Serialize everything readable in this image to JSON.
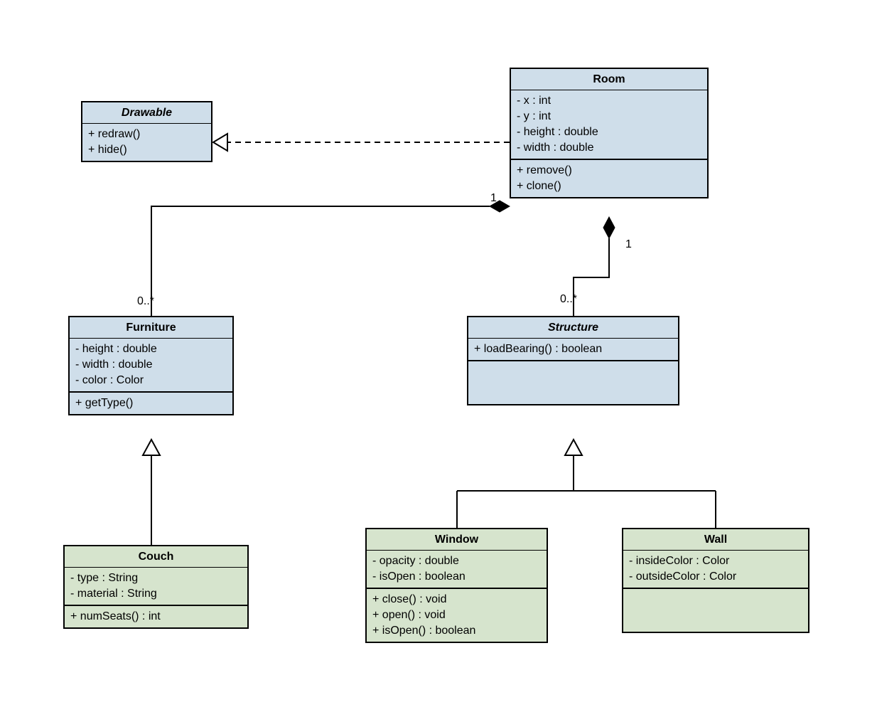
{
  "classes": {
    "drawable": {
      "name": "Drawable",
      "abstract": true,
      "methods": [
        "+ redraw()",
        "+ hide()"
      ]
    },
    "room": {
      "name": "Room",
      "attributes": [
        "- x : int",
        "- y : int",
        "- height : double",
        "- width : double"
      ],
      "methods": [
        "+ remove()",
        "+ clone()"
      ]
    },
    "furniture": {
      "name": "Furniture",
      "attributes": [
        "- height : double",
        "- width : double",
        "- color : Color"
      ],
      "methods": [
        "+ getType()"
      ]
    },
    "structure": {
      "name": "Structure",
      "abstract": true,
      "methods": [
        "+ loadBearing() : boolean"
      ]
    },
    "couch": {
      "name": "Couch",
      "attributes": [
        "- type : String",
        "- material : String"
      ],
      "methods": [
        "+ numSeats() : int"
      ]
    },
    "window": {
      "name": "Window",
      "attributes": [
        "- opacity : double",
        "- isOpen : boolean"
      ],
      "methods": [
        "+ close() : void",
        "+ open() : void",
        "+ isOpen() : boolean"
      ]
    },
    "wall": {
      "name": "Wall",
      "attributes": [
        "- insideColor : Color",
        "- outsideColor : Color"
      ]
    }
  },
  "relations": {
    "room_furniture": {
      "roomMult": "1",
      "furnitureMult": "0..*"
    },
    "room_structure": {
      "roomMult": "1",
      "structureMult": "0..*"
    }
  }
}
